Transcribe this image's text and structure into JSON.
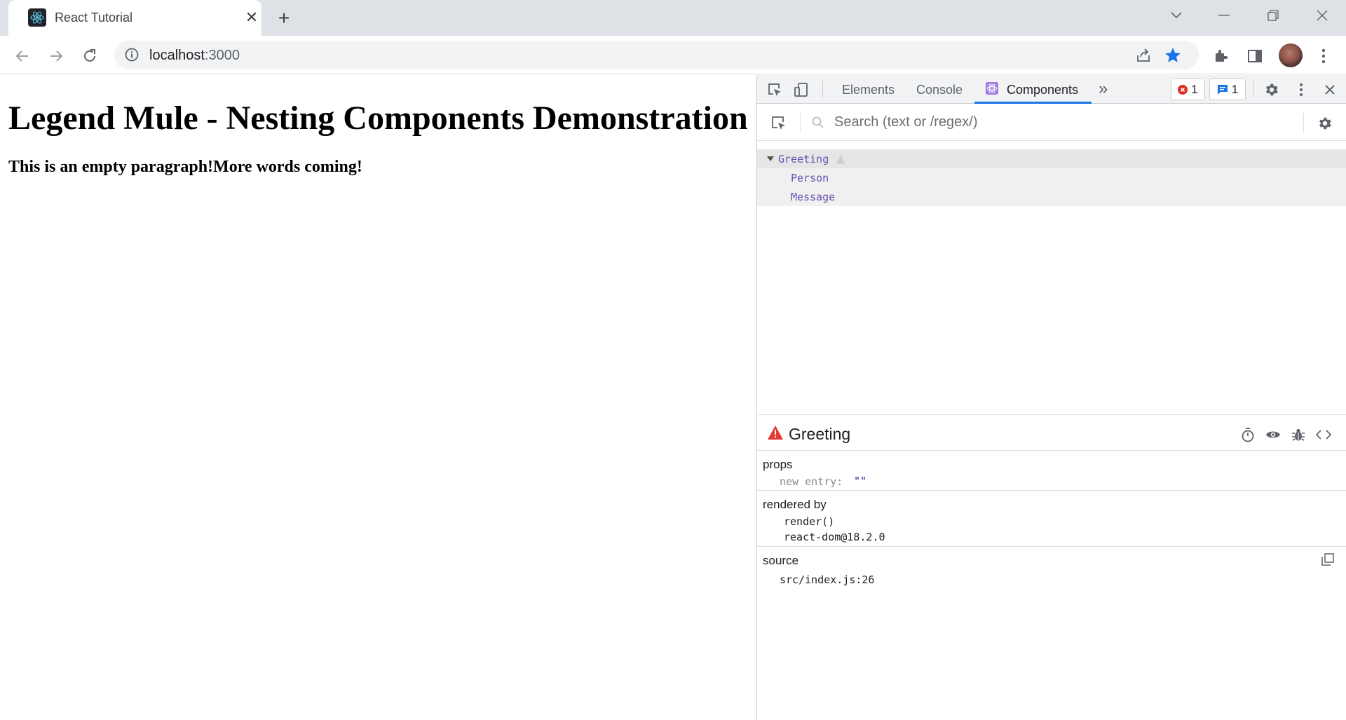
{
  "browser": {
    "tab_title": "React Tutorial",
    "tab_close": "✕",
    "new_tab": "+",
    "url_host": "localhost",
    "url_port": ":3000"
  },
  "page": {
    "heading": "Legend Mule - Nesting Components Demonstration",
    "paragraph": "This is an empty paragraph!More words coming!"
  },
  "devtools": {
    "tabs": [
      "Elements",
      "Console",
      "Components"
    ],
    "active_tab": "Components",
    "more_tabs": "»",
    "error_count": "1",
    "message_count": "1",
    "search_placeholder": "Search (text or /regex/)",
    "tree": [
      {
        "name": "Greeting",
        "depth": 0,
        "selected": true,
        "warning": true
      },
      {
        "name": "Person",
        "depth": 1
      },
      {
        "name": "Message",
        "depth": 1
      }
    ],
    "inspected": {
      "component": "Greeting",
      "props_title": "props",
      "props": [
        {
          "key": "new entry",
          "value": "\"\""
        }
      ],
      "rendered_by_title": "rendered by",
      "rendered_by": [
        "render()",
        "react-dom@18.2.0"
      ],
      "source_title": "source",
      "source": "src/index.js:26"
    }
  },
  "colors": {
    "accent": "#1a73e8",
    "component_name": "#6a51b2",
    "error": "#d93025",
    "warning_red": "#e53935"
  }
}
